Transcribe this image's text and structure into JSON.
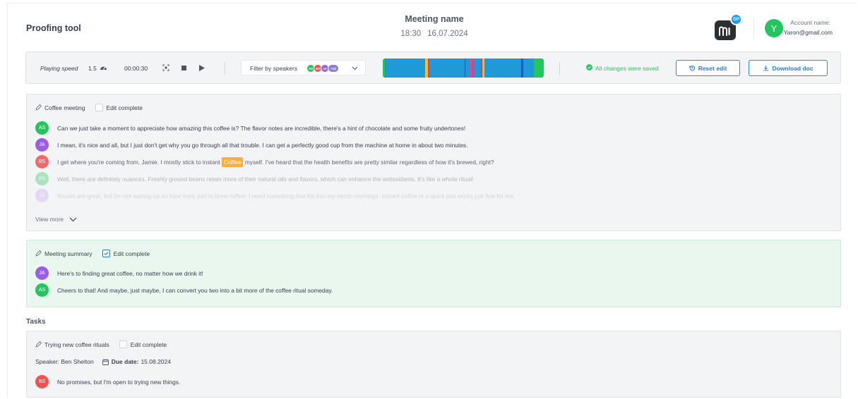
{
  "header": {
    "app_title": "Proofing tool",
    "meeting_name": "Meeting name",
    "meeting_time": "18:30",
    "meeting_date": "16.07.2024",
    "logo_badge": "OP",
    "account_initial": "Y",
    "account_label": "Account name:",
    "account_email": "Yaron@gmail.com"
  },
  "toolbar": {
    "playing_speed_label": "Playing speed",
    "playing_speed_value": "1.5",
    "time": "00:00:30",
    "filter_label": "Filter by speakers",
    "filter_chips": [
      "AS",
      "BS",
      "JA",
      "+10"
    ],
    "saved_text": "All changes were saved",
    "reset_label": "Reset edit",
    "download_label": "Download doc",
    "timeline_colors": [
      "#22c55e",
      "#e53e3e",
      "#1f9ad6",
      "#f6c028",
      "#e53e3e",
      "#1f9ad6",
      "#1560c0",
      "#1f9ad6",
      "#e24b7a",
      "#9a4fd6",
      "#1f9ad6",
      "#e53e3e",
      "#f6c028",
      "#1f9ad6",
      "#1560c0",
      "#1f9ad6",
      "#22c55e"
    ]
  },
  "colors": {
    "AS": "#22c55e",
    "JA": "#9b5de5",
    "BS": "#ef5350",
    "accent": "#1e7fd1",
    "saved": "#22c55e"
  },
  "transcript": {
    "title": "Coffee meeting",
    "edit_complete_label": "Edit complete",
    "messages": [
      {
        "speaker": "AS",
        "text": "Can we just take a moment to appreciate how amazing this coffee is? The flavor notes are incredible, there's a hint of chocolate and some fruity undertones!"
      },
      {
        "speaker": "JA",
        "text": "I mean, it's nice and all, but I just don't get why you go through all that  trouble. I can get a perfectly good cup from the machine at home in about two minutes."
      },
      {
        "speaker": "BS",
        "text_before": "I get where you're coming from, Jamie. I mostly stick to instant",
        "highlight": "Coffee",
        "text_after": "myself. I've heard that the health benefits are pretty similar regardless of how it's brewed, right?"
      },
      {
        "speaker": "AS",
        "text": "Well, there are definitely nuances. Freshly ground beans retain more of their natural oils and flavors, which can enhance the antioxidants. It's like a whole ritual!"
      },
      {
        "speaker": "JA",
        "text": "Rituals are great, but I'm not waking up an hour early just to brew coffee. I need something that fits into my hectic mornings. Instant coffee or a quick pod works just fine for me."
      }
    ],
    "view_more_label": "View more"
  },
  "summary": {
    "title": "Meeting summary",
    "edit_complete_label": "Edit complete",
    "messages": [
      {
        "speaker": "JA",
        "text": "Here's to finding great coffee, no matter how we drink it!"
      },
      {
        "speaker": "AS",
        "text": "Cheers to that! And maybe, just maybe, I can convert you two into a bit more of the coffee ritual someday."
      }
    ]
  },
  "tasks": {
    "heading": "Tasks",
    "items": [
      {
        "title": "Trying new coffee rituals",
        "edit_complete_label": "Edit complete",
        "speaker_text": "Speaker: Ben Shelton",
        "due_label": "Due date:",
        "due_value": "15.08.2024",
        "message": {
          "speaker": "BS",
          "text": "No promises, but I'm open to trying new things."
        }
      }
    ]
  }
}
